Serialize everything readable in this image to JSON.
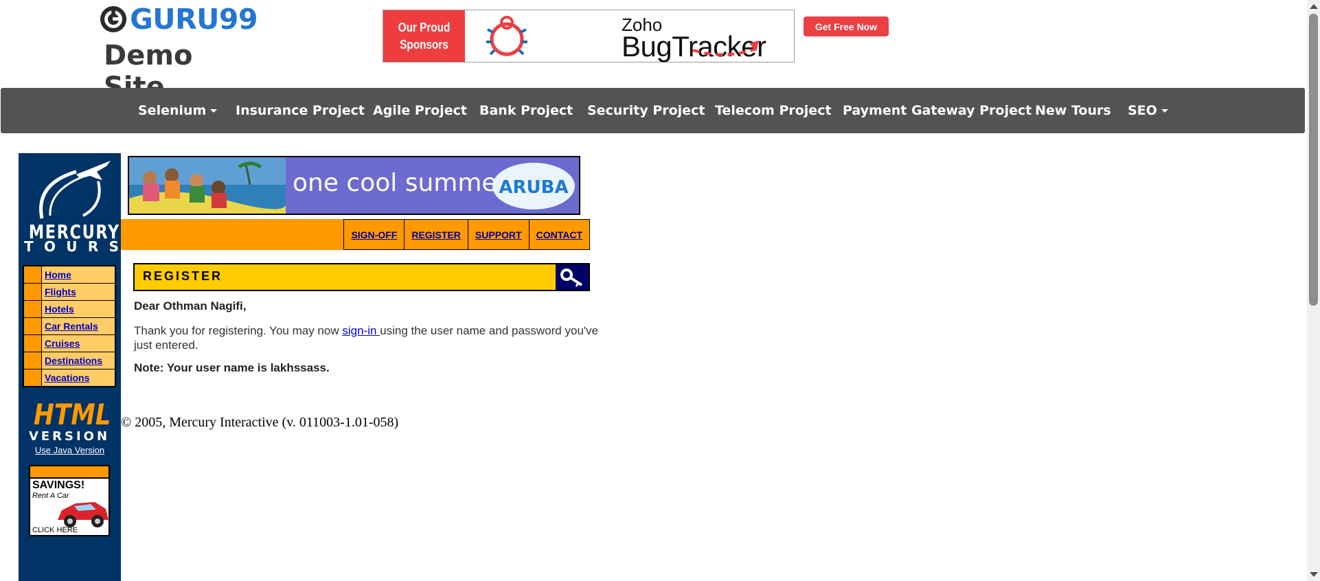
{
  "header": {
    "logo_text": "GURU99",
    "logo_subtitle": "Demo Site",
    "sponsor": {
      "label_line1": "Our Proud",
      "label_line2": "Sponsors",
      "brand_small": "Zoho",
      "brand_large": "BugTracker",
      "cta": "Get Free Now"
    }
  },
  "nav": {
    "items": [
      {
        "label": "Selenium",
        "dropdown": true
      },
      {
        "label": "Insurance Project",
        "dropdown": false
      },
      {
        "label": "Agile Project",
        "dropdown": false
      },
      {
        "label": "Bank Project",
        "dropdown": false
      },
      {
        "label": "Security Project",
        "dropdown": false
      },
      {
        "label": "Telecom Project",
        "dropdown": false
      },
      {
        "label": "Payment Gateway Project",
        "dropdown": false
      },
      {
        "label": "New Tours",
        "dropdown": false
      },
      {
        "label": "SEO",
        "dropdown": true
      }
    ]
  },
  "mercury": {
    "brand_line1": "MERCURY",
    "brand_line2": [
      "T",
      "O",
      "U",
      "R",
      "S"
    ],
    "menu": [
      "Home",
      "Flights",
      "Hotels",
      "Car Rentals",
      "Cruises",
      "Destinations",
      "Vacations"
    ],
    "html_badge": "HTML",
    "version_badge": "VERSION",
    "java_link": "Use Java Version",
    "savings": {
      "title": "SAVINGS!",
      "sub": "Rent A Car",
      "cta": "CLICK HERE"
    },
    "banner_text": "one cool summer",
    "banner_brand": "ARUBA",
    "toolbar": [
      "SIGN-OFF",
      "REGISTER",
      "SUPPORT",
      "CONTACT"
    ],
    "register_title": "REGISTER",
    "greeting": "Dear Othman Nagifi,",
    "thanks_before": "Thank you for registering. You may now ",
    "thanks_link": "sign-in ",
    "thanks_after": "using the user name and password you've just entered.",
    "note": "Note: Your user name is lakhssass.",
    "copyright": "© 2005, Mercury Interactive (v. 011003-1.01-058)"
  },
  "colors": {
    "nav_bg": "#535353",
    "guru_blue": "#2376d3",
    "mercury_navy": "#003366",
    "mercury_orange": "#ff9900",
    "register_yellow": "#ffcc00",
    "sponsor_red": "#ee3d3f"
  }
}
